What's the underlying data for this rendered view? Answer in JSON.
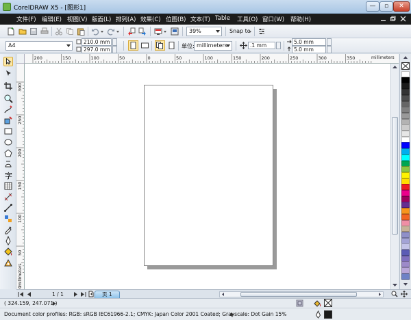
{
  "window": {
    "title": "CorelDRAW X5 - [图形1]",
    "minimize_glyph": "—",
    "maximize_glyph": "▫",
    "close_glyph": "✕"
  },
  "menu": {
    "items": [
      "文件(F)",
      "编辑(E)",
      "视图(V)",
      "版面(L)",
      "排列(A)",
      "效果(C)",
      "位图(B)",
      "文本(T)",
      "Table",
      "工具(O)",
      "窗口(W)",
      "帮助(H)"
    ]
  },
  "toolbar": {
    "zoom_value": "39%",
    "snap_label": "Snap to"
  },
  "property_bar": {
    "paper_size": "A4",
    "width": "210.0 mm",
    "height": "297.0 mm",
    "units_label": "单位:",
    "units_value": "millimeters",
    "nudge": ".1 mm",
    "dup_x": "5.0 mm",
    "dup_y": "5.0 mm"
  },
  "rulers": {
    "h_ticks": [
      "200",
      "150",
      "100",
      "50",
      "0",
      "50",
      "100",
      "150",
      "200",
      "250",
      "300",
      "350"
    ],
    "h_unit": "millimeters",
    "v_ticks": [
      "300",
      "250",
      "200",
      "150",
      "100",
      "50",
      "0"
    ],
    "v_unit": "millimeters"
  },
  "navigator": {
    "page_count": "1 / 1",
    "page_tab": "页 1"
  },
  "status": {
    "coordinates": "( 324.159, 247.071 )",
    "color_profiles": "Document color profiles: RGB: sRGB IEC61966-2.1; CMYK: Japan Color 2001 Coated; Grayscale: Dot Gain 15%"
  },
  "colors": {
    "menu_bg": "#1c1c1c",
    "page_tab": "#8fc3ea",
    "palette": [
      "#ffffff",
      "#000000",
      "#1a1a1a",
      "#333333",
      "#4d4d4d",
      "#666666",
      "#808080",
      "#999999",
      "#b3b3b3",
      "#cccccc",
      "#e6e6e6",
      "#ffffff",
      "#0000ff",
      "#00aeef",
      "#00ffff",
      "#00a651",
      "#8dc63f",
      "#fff200",
      "#ffde00",
      "#ed1c24",
      "#ec008c",
      "#9e005d",
      "#662d91",
      "#f7941d",
      "#f26522",
      "#ef8ea5",
      "#c7b299",
      "#8f8fc8",
      "#a3a3d6",
      "#c3c3e8",
      "#5b5bb5",
      "#7f6fbf",
      "#9d8ac9",
      "#b8a6d9",
      "#6e82c6"
    ]
  }
}
